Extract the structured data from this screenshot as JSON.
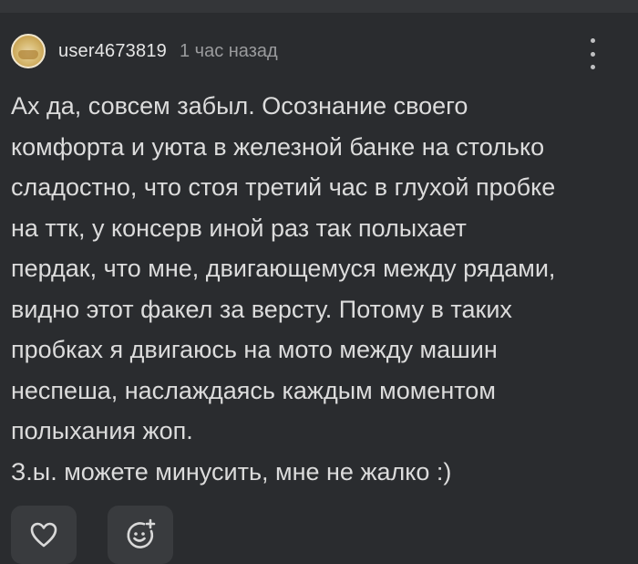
{
  "comment": {
    "username": "user4673819",
    "time": "1 час назад",
    "lines": [
      "Ах да, совсем забыл. Осознание своего",
      "комфорта и уюта в железной банке на столько",
      "сладостно, что стоя третий час в глухой пробке",
      "на ттк, у консерв иной раз так полыхает",
      "пердак, что мне, двигающемуся между рядами,",
      "видно этот факел за версту. Потому в таких",
      "пробках я двигаюсь на мото между машин",
      "неспеша, наслаждаясь каждым моментом",
      "полыхания жоп.",
      "З.ы. можете минусить, мне не жалко :)"
    ]
  },
  "icons": {
    "menu": "more-vertical-icon",
    "like": "heart-icon",
    "react": "smile-add-icon"
  },
  "colors": {
    "background": "#2a2c2f",
    "button_bg": "#393b3e",
    "text": "#dcdcdc",
    "muted": "#9a9b9d"
  }
}
